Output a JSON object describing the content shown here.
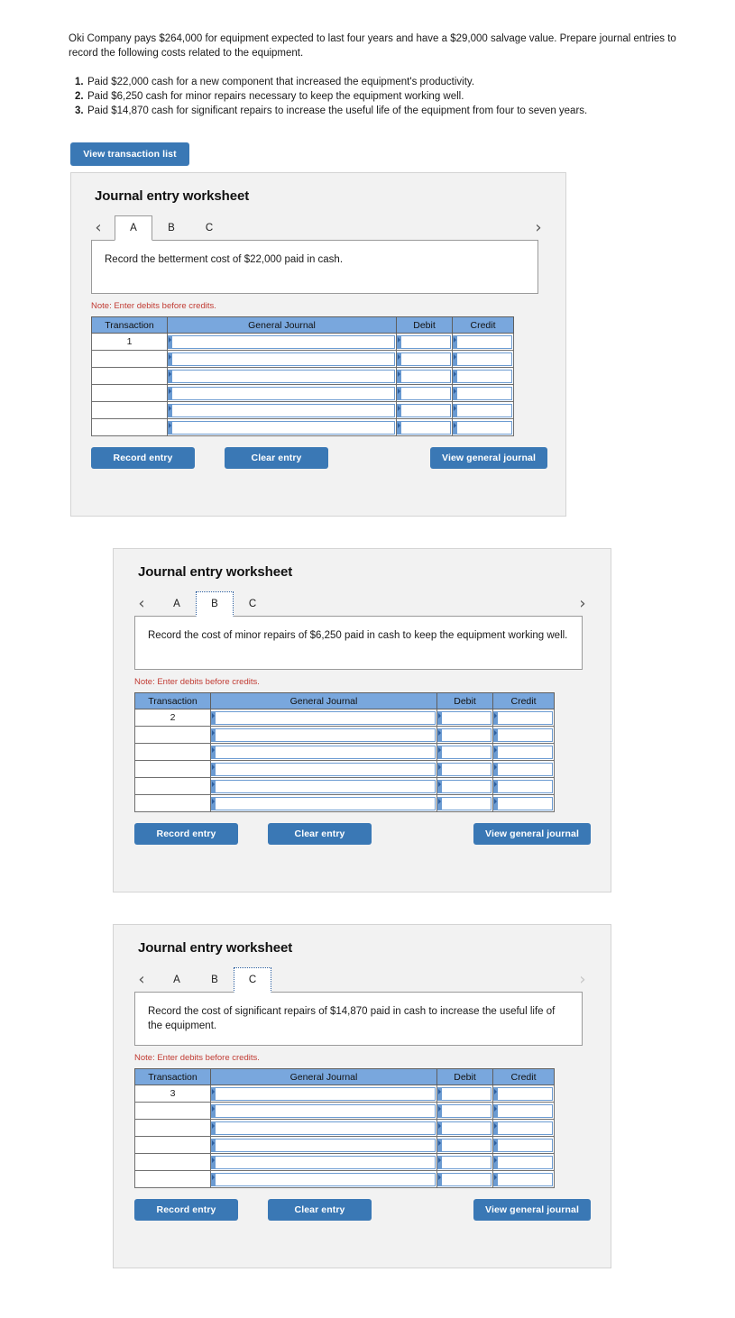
{
  "problem": {
    "intro": "Oki Company pays $264,000 for equipment expected to last four years and have a $29,000 salvage value. Prepare journal entries to record the following costs related to the equipment.",
    "items": [
      {
        "num": "1.",
        "text": "Paid $22,000 cash for a new component that increased the equipment's productivity."
      },
      {
        "num": "2.",
        "text": "Paid $6,250 cash for minor repairs necessary to keep the equipment working well."
      },
      {
        "num": "3.",
        "text": "Paid $14,870 cash for significant repairs to increase the useful life of the equipment from four to seven years."
      }
    ]
  },
  "toolbar": {
    "view_transaction_list": "View transaction list"
  },
  "common": {
    "worksheet_title": "Journal entry worksheet",
    "note": "Note: Enter debits before credits.",
    "prev_icon": "‹",
    "next_icon": "›",
    "columns": [
      "Transaction",
      "General Journal",
      "Debit",
      "Credit"
    ],
    "record_entry": "Record entry",
    "clear_entry": "Clear entry",
    "view_general_journal": "View general journal",
    "row_count": 6
  },
  "colors": {
    "button_blue": "#3a78b5",
    "table_header_blue": "#79a7dd",
    "input_border_blue": "#6b9bd2",
    "note_red": "#c13b33",
    "panel_bg": "#f2f2f2"
  },
  "panels": [
    {
      "id": "A",
      "title": "Journal entry worksheet",
      "tabs": [
        "A",
        "B",
        "C"
      ],
      "active_tab": "A",
      "tab_focused": false,
      "next_disabled": false,
      "description": "Record the betterment cost of $22,000 paid in cash.",
      "transaction_number": "1"
    },
    {
      "id": "B",
      "title": "Journal entry worksheet",
      "tabs": [
        "A",
        "B",
        "C"
      ],
      "active_tab": "B",
      "tab_focused": true,
      "next_disabled": false,
      "description": "Record the cost of minor repairs of $6,250 paid in cash to keep the equipment working well.",
      "transaction_number": "2"
    },
    {
      "id": "C",
      "title": "Journal entry worksheet",
      "tabs": [
        "A",
        "B",
        "C"
      ],
      "active_tab": "C",
      "tab_focused": true,
      "next_disabled": true,
      "description": "Record the cost of significant repairs of $14,870 paid in cash to increase the useful life of the equipment.",
      "transaction_number": "3"
    }
  ]
}
